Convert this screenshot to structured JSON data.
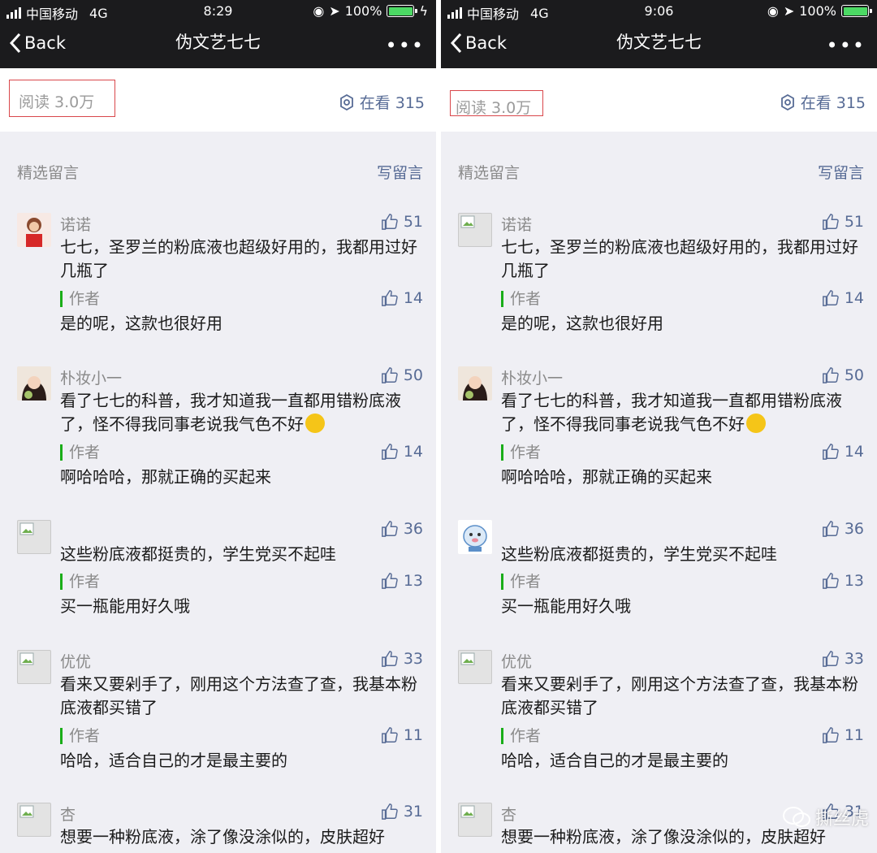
{
  "status_left": {
    "carrier": "中国移动",
    "network": "4G",
    "time": "8:29",
    "battery": "100%"
  },
  "status_right": {
    "carrier": "中国移动",
    "network": "4G",
    "time": "9:06",
    "battery": "100%"
  },
  "nav": {
    "back": "Back",
    "title": "伪文艺七七"
  },
  "read_count": "阅读 3.0万",
  "watching": "在看 315",
  "section_title": "精选留言",
  "write_comment": "写留言",
  "comments": [
    {
      "author": "诺诺",
      "likes": "51",
      "text": "七七，圣罗兰的粉底液也超级好用的，我都用过好几瓶了",
      "reply_label": "作者",
      "reply_likes": "14",
      "reply": "是的呢，这款也很好用"
    },
    {
      "author": "朴妆小一",
      "likes": "50",
      "text": "看了七七的科普，我才知道我一直都用错粉底液了，怪不得我同事老说我气色不好",
      "reply_label": "作者",
      "reply_likes": "14",
      "reply": "啊哈哈哈，那就正确的买起来"
    },
    {
      "author": "",
      "likes": "36",
      "text": "这些粉底液都挺贵的，学生党买不起哇",
      "reply_label": "作者",
      "reply_likes": "13",
      "reply": "买一瓶能用好久哦"
    },
    {
      "author": "优优",
      "likes": "33",
      "text": "看来又要剁手了，刚用这个方法查了查，我基本粉底液都买错了",
      "reply_label": "作者",
      "reply_likes": "11",
      "reply": "哈哈，适合自己的才是最主要的"
    },
    {
      "author": "杏",
      "likes": "31",
      "text": "想要一种粉底液，涂了像没涂似的，皮肤超好"
    }
  ],
  "watermark": "撕丝虎",
  "colors": {
    "link": "#576b95",
    "author_bar": "#1aad19",
    "highlight_box": "#d9474b",
    "bar_bg": "#1b1b1d"
  }
}
